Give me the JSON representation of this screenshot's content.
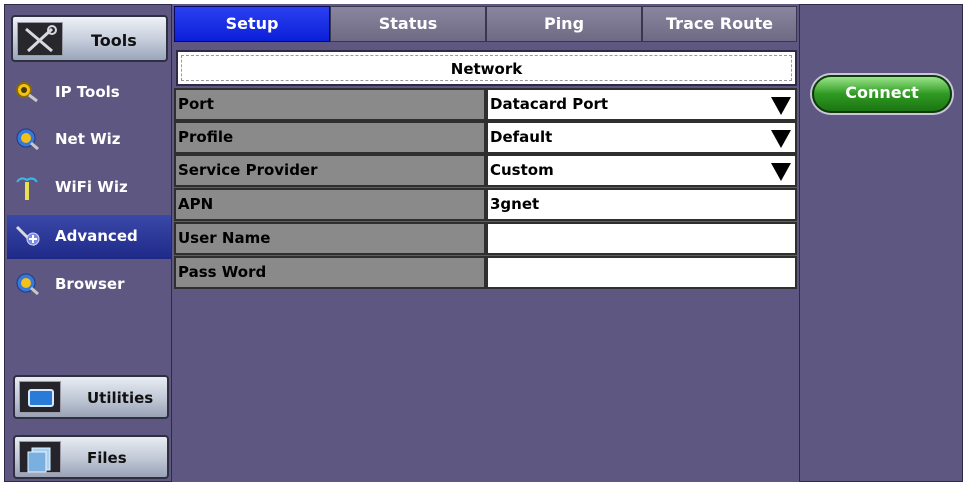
{
  "sidebar": {
    "tools_label": "Tools",
    "items": [
      {
        "label": "IP Tools"
      },
      {
        "label": "Net Wiz"
      },
      {
        "label": "WiFi Wiz"
      },
      {
        "label": "Advanced"
      },
      {
        "label": "Browser"
      }
    ],
    "utilities_label": "Utilities",
    "files_label": "Files"
  },
  "tabs": [
    {
      "label": "Setup"
    },
    {
      "label": "Status"
    },
    {
      "label": "Ping"
    },
    {
      "label": "Trace Route"
    }
  ],
  "network": {
    "title": "Network",
    "rows": [
      {
        "label": "Port",
        "value": "Datacard Port"
      },
      {
        "label": "Profile",
        "value": "Default"
      },
      {
        "label": "Service Provider",
        "value": "Custom"
      },
      {
        "label": "APN",
        "value": "3gnet"
      },
      {
        "label": "User Name",
        "value": ""
      },
      {
        "label": "Pass Word",
        "value": ""
      }
    ]
  },
  "actions": {
    "connect_label": "Connect"
  },
  "colors": {
    "panel": "#5e5782",
    "active_tab": "#0c1fd8",
    "active_nav": "#2a3598",
    "connect": "#2f9a22"
  }
}
